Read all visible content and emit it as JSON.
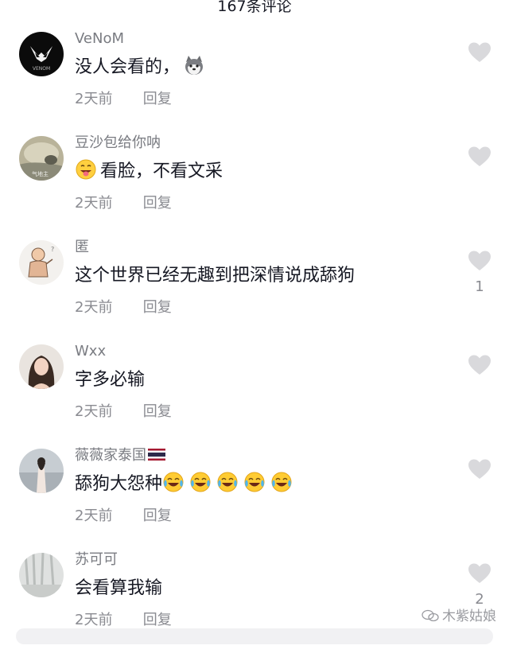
{
  "header": {
    "title": "167条评论"
  },
  "comments": [
    {
      "username": "VeNoM",
      "text": "没人会看的，",
      "time": "2天前",
      "reply": "回复",
      "likes": "",
      "emoji": "husky-face"
    },
    {
      "username": "豆沙包给你呐",
      "text": "看脸，不看文采",
      "time": "2天前",
      "reply": "回复",
      "likes": "",
      "emoji": "tongue-grin-face"
    },
    {
      "username": "匿",
      "text": "这个世界已经无趣到把深情说成舔狗",
      "time": "2天前",
      "reply": "回复",
      "likes": "1"
    },
    {
      "username": "Wxx",
      "text": "字多必输",
      "time": "2天前",
      "reply": "回复",
      "likes": ""
    },
    {
      "username": "薇薇家泰国",
      "text": "舔狗大怨种",
      "time": "2天前",
      "reply": "回复",
      "likes": "",
      "flag": "thailand-flag",
      "emoji": "tears-of-joy-face ×5"
    },
    {
      "username": "苏可可",
      "text": "会看算我输",
      "time": "2天前",
      "reply": "回复",
      "likes": "2"
    }
  ],
  "watermark": {
    "text": "木紫姑娘"
  },
  "colors": {
    "text": "#161823",
    "secondary": "#8a8b91",
    "like_icon": "#d9d9dc"
  }
}
